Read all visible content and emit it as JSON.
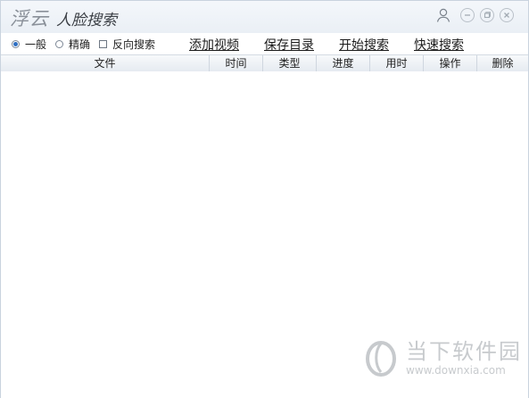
{
  "app": {
    "brand": "浮云",
    "product": "人脸搜索"
  },
  "search_modes": [
    {
      "label": "一般",
      "checked": true
    },
    {
      "label": "精确",
      "checked": false
    }
  ],
  "reverse_search": {
    "label": "反向搜索",
    "checked": false
  },
  "actions": {
    "add_video": "添加视频",
    "save_dir": "保存目录",
    "start_search": "开始搜索",
    "fast_search": "快速搜索"
  },
  "columns": {
    "file": "文件",
    "time": "时间",
    "type": "类型",
    "progress": "进度",
    "elapsed": "用时",
    "operation": "操作",
    "delete": "删除"
  },
  "rows": [],
  "watermark": {
    "site_name": "当下软件园",
    "site_url": "www.downxia.com"
  },
  "colors": {
    "accent": "#2f6fc2",
    "header_bg": "#eaeff5",
    "border": "#c9d1db"
  }
}
